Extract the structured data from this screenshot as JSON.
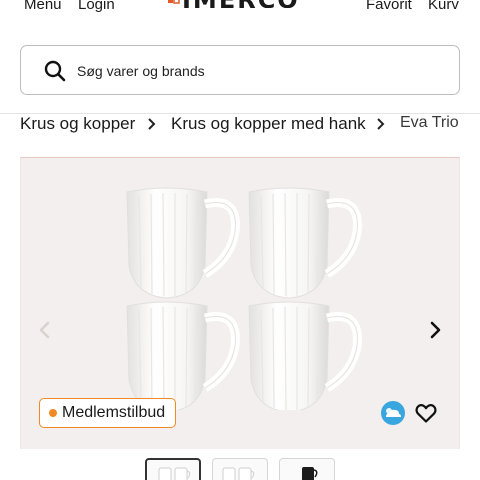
{
  "header": {
    "menu_label": "Menu",
    "login_label": "Login",
    "logo_text": "IMERCO",
    "favorites_label": "Favorit",
    "cart_label": "Kurv"
  },
  "search": {
    "placeholder": "Søg varer og brands",
    "icon": "search-icon"
  },
  "breadcrumb": [
    "Krus og kopper",
    "Krus og kopper med hank",
    "Eva Trio"
  ],
  "gallery": {
    "badge_label": "Medlemstilbud",
    "badge_color": "#f08a24",
    "prev_icon": "chevron-left-icon",
    "next_icon": "chevron-right-icon",
    "thumbnails": [
      "white-mug-set",
      "white-mug-set",
      "black-mug"
    ]
  },
  "colors": {
    "accent": "#f08a24",
    "gallery_bg": "#f3efee"
  }
}
